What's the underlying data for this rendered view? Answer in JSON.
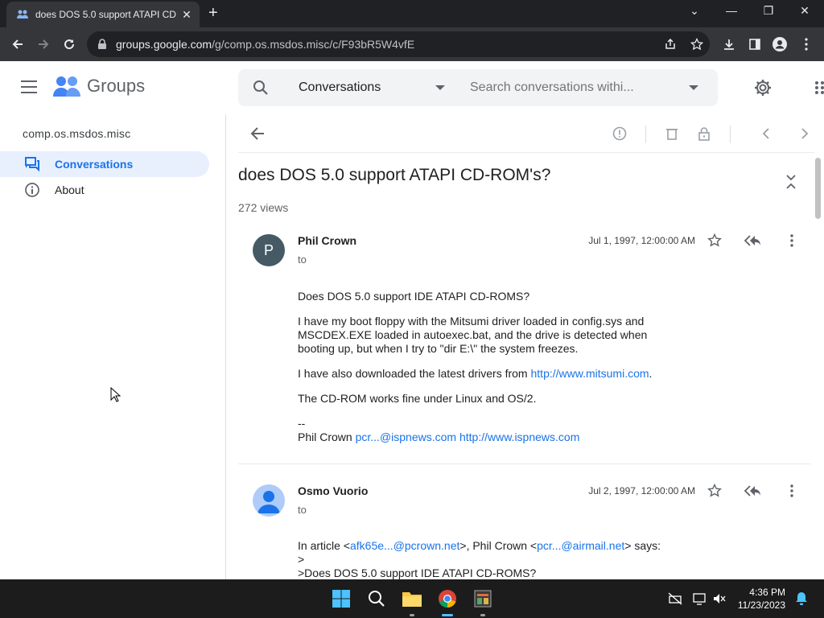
{
  "browser": {
    "tab_title": "does DOS 5.0 support ATAPI CD",
    "tab_close": "✕",
    "new_tab": "+",
    "url_host": "groups.google.com",
    "url_path": "/g/comp.os.msdos.misc/c/F93bR5W4vfE",
    "window_controls": {
      "minimize": "—",
      "maximize": "❐",
      "close": "✕",
      "tab_search": "⌄"
    }
  },
  "app": {
    "brand": "Groups",
    "search_scope": "Conversations",
    "search_placeholder": "Search conversations withi...",
    "colors": {
      "accent": "#1a73e8",
      "active_bg": "#e8f0fe"
    }
  },
  "sidebar": {
    "group_name": "comp.os.msdos.misc",
    "items": [
      {
        "label": "Conversations",
        "icon": "conversations-icon",
        "active": true
      },
      {
        "label": "About",
        "icon": "info-icon",
        "active": false
      }
    ]
  },
  "thread": {
    "title": "does DOS 5.0 support ATAPI CD-ROM's?",
    "views": "272 views",
    "messages": [
      {
        "author": "Phil Crown",
        "avatar_letter": "P",
        "to": "to",
        "date": "Jul 1, 1997, 12:00:00 AM",
        "paragraphs": [
          "Does DOS 5.0 support IDE ATAPI CD-ROMS?",
          "I have my boot floppy with the Mitsumi driver loaded in config.sys and MSCDEX.EXE loaded in autoexec.bat, and the drive is detected when booting up, but when I try to \"dir E:\\\" the system freezes.",
          "I have also downloaded the latest drivers from",
          "The CD-ROM works fine under Linux and OS/2.",
          "--",
          "Phil Crown"
        ],
        "links": {
          "mitsumi": "http://www.mitsumi.com",
          "email": "pcr...@ispnews.com",
          "site": "http://www.ispnews.com"
        },
        "period": "."
      },
      {
        "author": "Osmo Vuorio",
        "to": "to",
        "date": "Jul 2, 1997, 12:00:00 AM",
        "quote_prefix": "In article <",
        "quote_link1": "afk65e...@pcrown.net",
        "quote_mid": ">, Phil Crown <",
        "quote_link2": "pcr...@airmail.net",
        "quote_suffix": "> says:",
        "quote_line1": ">",
        "quote_line2": ">Does DOS 5.0 support IDE ATAPI CD-ROMS?"
      }
    ]
  },
  "taskbar": {
    "time": "4:36 PM",
    "date": "11/23/2023"
  }
}
